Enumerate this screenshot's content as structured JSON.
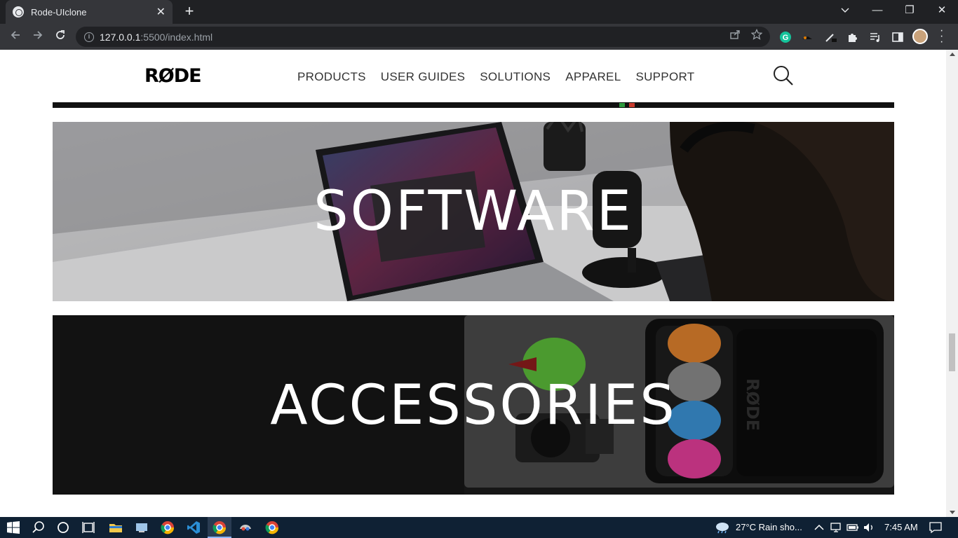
{
  "browser": {
    "tab_title": "Rode-UIclone",
    "tab_close": "✕",
    "new_tab": "+",
    "url_host": "127.0.0.1",
    "url_rest": ":5500/index.html",
    "window_controls": {
      "minimize": "—",
      "restore": "❐",
      "close": "✕"
    }
  },
  "site": {
    "logo": "RØDE",
    "nav": [
      "PRODUCTS",
      "USER GUIDES",
      "SOLUTIONS",
      "APPAREL",
      "SUPPORT"
    ],
    "banners": [
      {
        "title": "SOFTWARE"
      },
      {
        "title": "ACCESSORIES"
      }
    ]
  },
  "taskbar": {
    "weather": "27°C  Rain sho...",
    "time": "7:45 AM"
  },
  "icons": {
    "back": "back-arrow-icon",
    "forward": "forward-arrow-icon",
    "reload": "reload-icon",
    "search": "search-icon"
  }
}
